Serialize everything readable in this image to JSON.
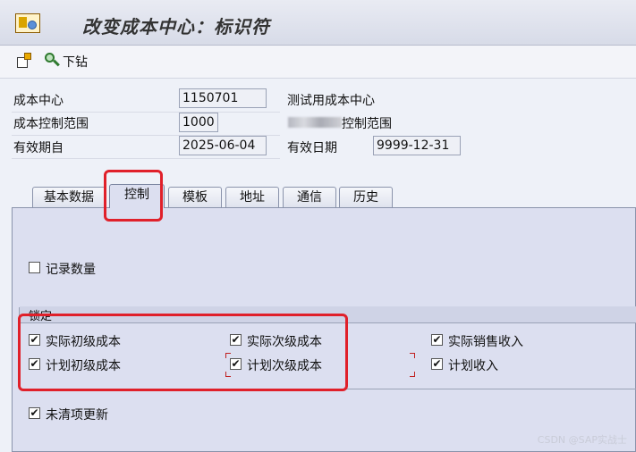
{
  "window": {
    "title": "改变成本中心：标识符"
  },
  "toolbar": {
    "icon_other": "other-object-icon",
    "drilldown_label": "下钻"
  },
  "header": {
    "cost_center_label": "成本中心",
    "cost_center_value": "1150701",
    "cost_center_desc": "测试用成本中心",
    "controlling_area_label": "成本控制范围",
    "controlling_area_value": "1000",
    "controlling_area_desc": "控制范围",
    "valid_from_label": "有效期自",
    "valid_from_value": "2025-06-04",
    "valid_to_label": "有效日期",
    "valid_to_value": "9999-12-31"
  },
  "tabs": [
    {
      "label": "基本数据",
      "active": false
    },
    {
      "label": "控制",
      "active": true
    },
    {
      "label": "模板",
      "active": false
    },
    {
      "label": "地址",
      "active": false
    },
    {
      "label": "通信",
      "active": false
    },
    {
      "label": "历史",
      "active": false
    }
  ],
  "control_tab": {
    "record_quantity": {
      "label": "记录数量",
      "checked": false
    },
    "lock_group": {
      "title": "锁定",
      "items": [
        {
          "label": "实际初级成本",
          "checked": true
        },
        {
          "label": "实际次级成本",
          "checked": true
        },
        {
          "label": "实际销售收入",
          "checked": true
        },
        {
          "label": "计划初级成本",
          "checked": true
        },
        {
          "label": "计划次级成本",
          "checked": true
        },
        {
          "label": "计划收入",
          "checked": true
        }
      ]
    },
    "open_items_update": {
      "label": "未清项更新",
      "checked": true
    }
  },
  "colors": {
    "highlight": "#e0202a",
    "panel": "#dcdff0"
  },
  "watermark": "CSDN @SAP实战士"
}
